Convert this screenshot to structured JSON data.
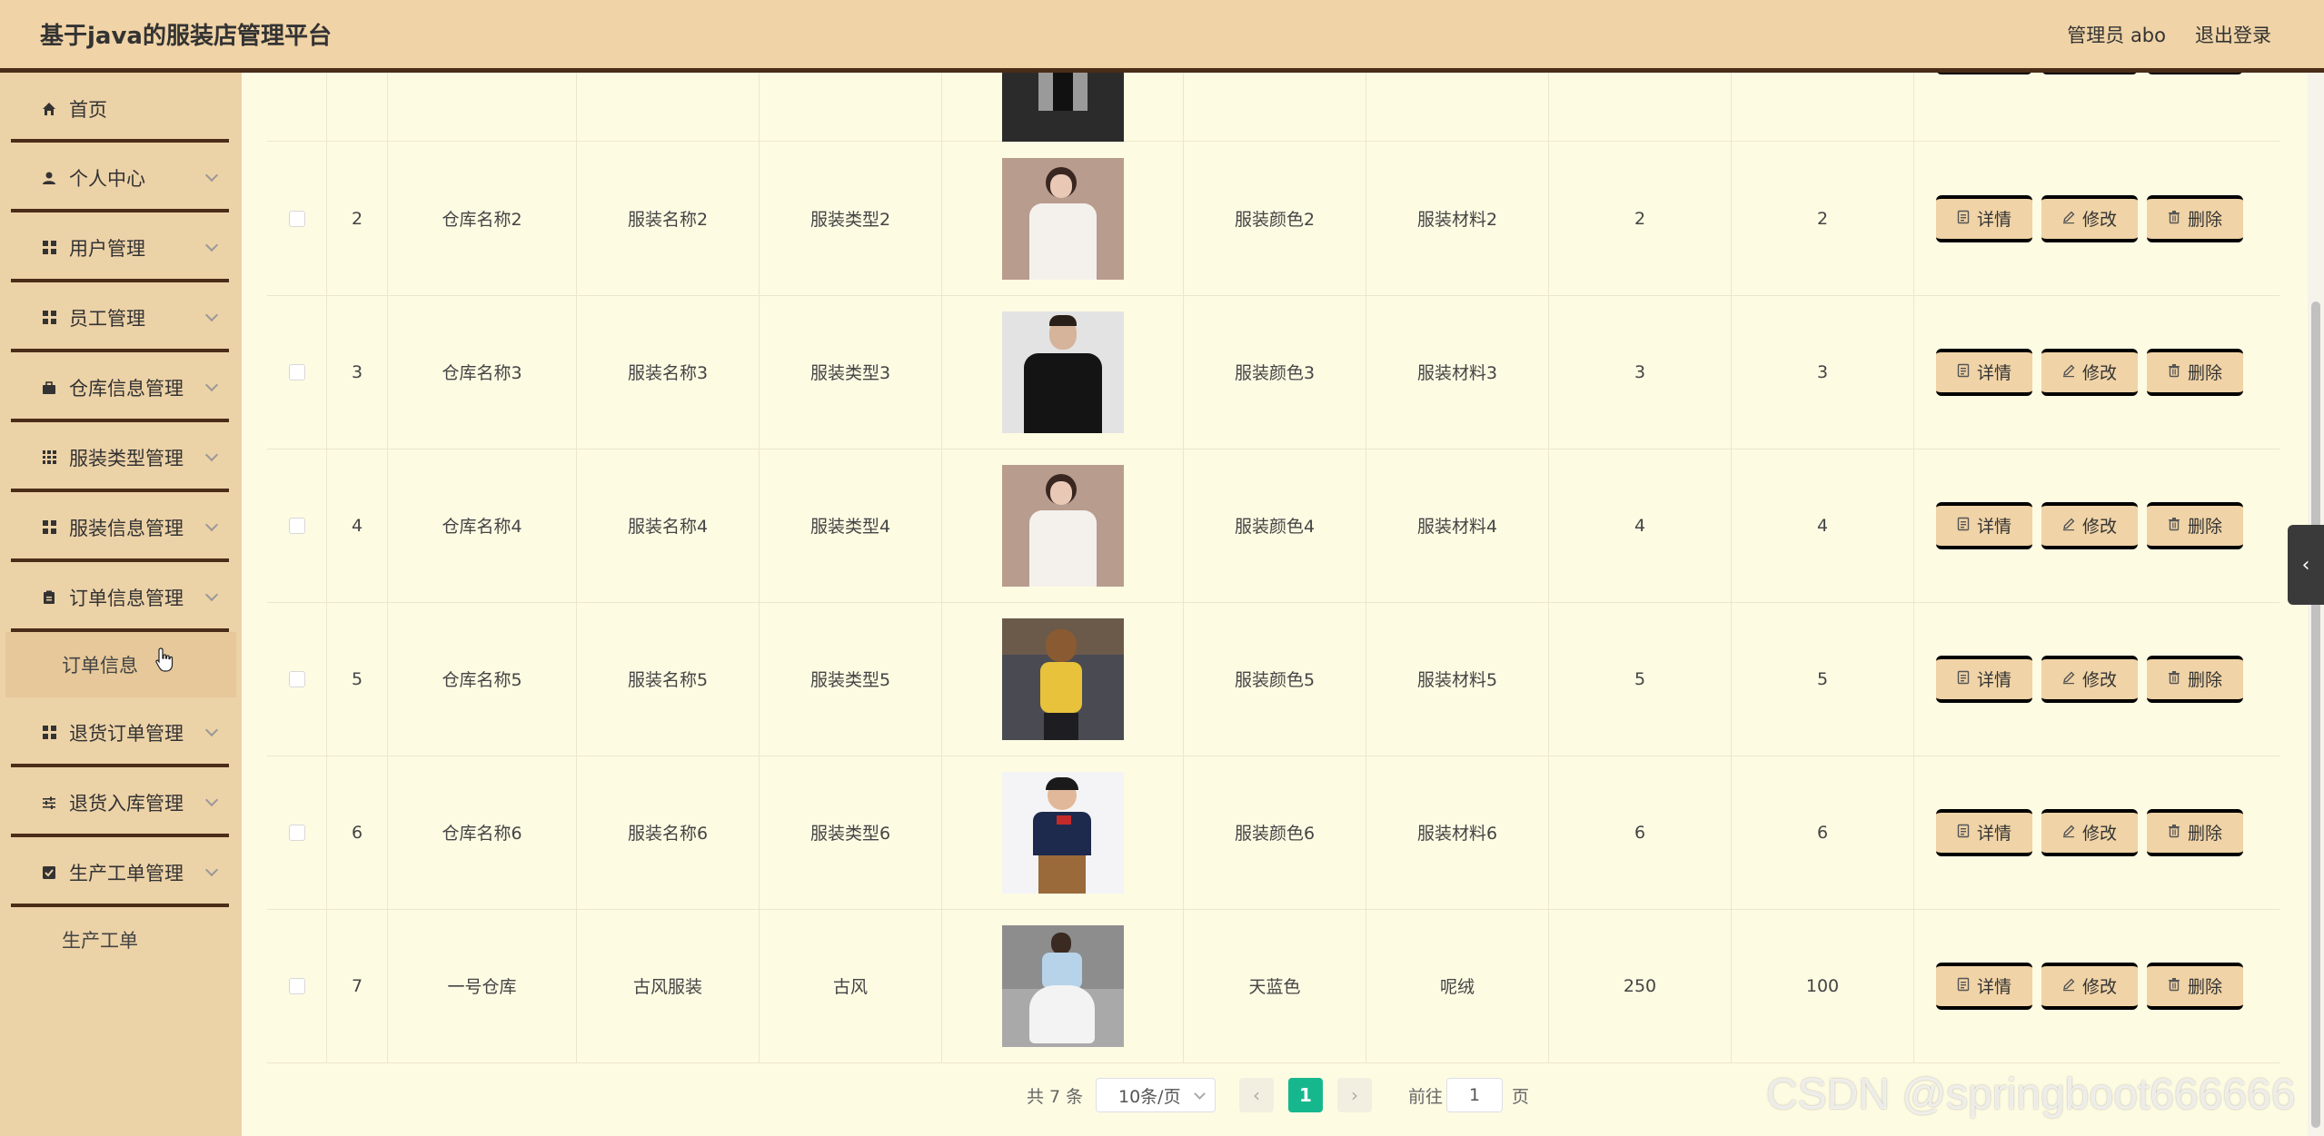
{
  "header": {
    "title": "基于java的服装店管理平台",
    "user": "管理员 abo",
    "logout": "退出登录"
  },
  "sidebar": {
    "items": [
      {
        "label": "首页",
        "icon": "home-icon"
      },
      {
        "label": "个人中心",
        "icon": "user-icon"
      },
      {
        "label": "用户管理",
        "icon": "grid-icon"
      },
      {
        "label": "员工管理",
        "icon": "grid-icon"
      },
      {
        "label": "仓库信息管理",
        "icon": "briefcase-icon"
      },
      {
        "label": "服装类型管理",
        "icon": "grid9-icon"
      },
      {
        "label": "服装信息管理",
        "icon": "grid-icon"
      },
      {
        "label": "订单信息管理",
        "icon": "clipboard-icon"
      },
      {
        "label": "订单信息",
        "icon": ""
      },
      {
        "label": "退货订单管理",
        "icon": "grid-icon"
      },
      {
        "label": "退货入库管理",
        "icon": "sliders-icon"
      },
      {
        "label": "生产工单管理",
        "icon": "check-square-icon"
      },
      {
        "label": "生产工单",
        "icon": ""
      }
    ]
  },
  "table": {
    "rows": [
      {
        "idx": "2",
        "warehouse": "仓库名称2",
        "name": "服装名称2",
        "type": "服装类型2",
        "color": "服装颜色2",
        "material": "服装材料2",
        "n1": "2",
        "n2": "2",
        "img": "white-blouse"
      },
      {
        "idx": "3",
        "warehouse": "仓库名称3",
        "name": "服装名称3",
        "type": "服装类型3",
        "color": "服装颜色3",
        "material": "服装材料3",
        "n1": "3",
        "n2": "3",
        "img": "black-tshirt"
      },
      {
        "idx": "4",
        "warehouse": "仓库名称4",
        "name": "服装名称4",
        "type": "服装类型4",
        "color": "服装颜色4",
        "material": "服装材料4",
        "n1": "4",
        "n2": "4",
        "img": "white-blouse"
      },
      {
        "idx": "5",
        "warehouse": "仓库名称5",
        "name": "服装名称5",
        "type": "服装类型5",
        "color": "服装颜色5",
        "material": "服装材料5",
        "n1": "5",
        "n2": "5",
        "img": "yellow-top"
      },
      {
        "idx": "6",
        "warehouse": "仓库名称6",
        "name": "服装名称6",
        "type": "服装类型6",
        "color": "服装颜色6",
        "material": "服装材料6",
        "n1": "6",
        "n2": "6",
        "img": "kid-polo"
      },
      {
        "idx": "7",
        "warehouse": "一号仓库",
        "name": "古风服装",
        "type": "古风",
        "color": "天蓝色",
        "material": "呢绒",
        "n1": "250",
        "n2": "100",
        "img": "hanfu"
      }
    ],
    "actions": {
      "detail": "详情",
      "edit": "修改",
      "delete": "删除"
    }
  },
  "pager": {
    "total": "共 7 条",
    "page_size": "10条/页",
    "current": "1",
    "goto_label": "前往",
    "goto_value": "1",
    "page_unit": "页"
  },
  "watermark": "CSDN @springboot666666",
  "colors": {
    "accent": "#17b78e",
    "header": "#f0d3a6",
    "sidebar": "#ecd2a7",
    "border_dark": "#4a2d18"
  }
}
